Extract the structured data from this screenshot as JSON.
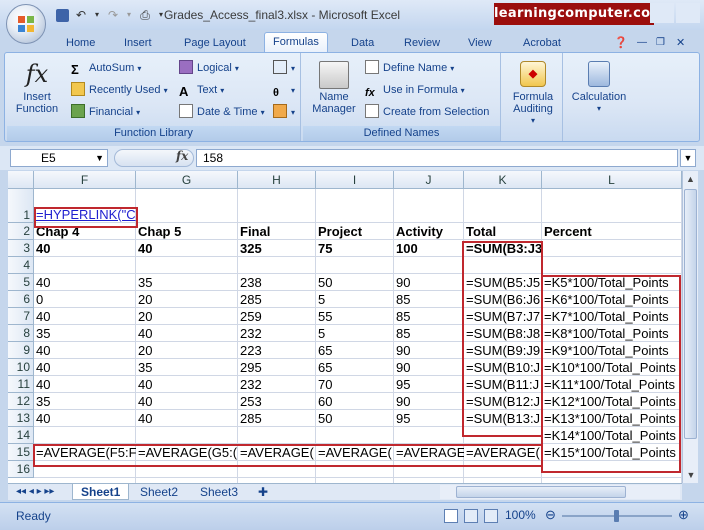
{
  "window": {
    "title": "Grades_Access_final3.xlsx - Microsoft Excel",
    "brand": "learningcomputer.com"
  },
  "ribbon": {
    "tabs": [
      "Home",
      "Insert",
      "Page Layout",
      "Formulas",
      "Data",
      "Review",
      "View",
      "Acrobat"
    ],
    "active_tab": "Formulas",
    "function_library": {
      "insert_function": "Insert\nFunction",
      "autosum": "AutoSum",
      "recently_used": "Recently Used",
      "financial": "Financial",
      "logical": "Logical",
      "text": "Text",
      "date_time": "Date & Time",
      "label": "Function Library"
    },
    "defined_names": {
      "name_manager": "Name\nManager",
      "define_name": "Define Name",
      "use_in_formula": "Use in Formula",
      "create_from_selection": "Create from Selection",
      "label": "Defined Names"
    },
    "formula_auditing": "Formula\nAuditing",
    "calculation": "Calculation"
  },
  "formula_bar": {
    "name_box": "E5",
    "fx": "fx",
    "value": "158"
  },
  "grid": {
    "columns": [
      "F",
      "G",
      "H",
      "I",
      "J",
      "K",
      "L"
    ],
    "rows": [
      "1",
      "2",
      "3",
      "4",
      "5",
      "6",
      "7",
      "8",
      "9",
      "10",
      "11",
      "12",
      "13",
      "14",
      "15",
      "16"
    ],
    "cells": {
      "F1": "=HYPERLINK(\"C",
      "F2": "Chap 4",
      "G2": "Chap 5",
      "H2": "Final",
      "I2": "Project",
      "J2": "Activity",
      "K2": "Total",
      "L2": "Percent",
      "F3": "40",
      "G3": "40",
      "H3": "325",
      "I3": "75",
      "J3": "100",
      "K3": "=SUM(B3:J3",
      "F5": "40",
      "G5": "35",
      "H5": "238",
      "I5": "50",
      "J5": "90",
      "K5": "=SUM(B5:J5",
      "L5": "=K5*100/Total_Points",
      "F6": "0",
      "G6": "20",
      "H6": "285",
      "I6": "5",
      "J6": "85",
      "K6": "=SUM(B6:J6",
      "L6": "=K6*100/Total_Points",
      "F7": "40",
      "G7": "20",
      "H7": "259",
      "I7": "55",
      "J7": "85",
      "K7": "=SUM(B7:J7",
      "L7": "=K7*100/Total_Points",
      "F8": "35",
      "G8": "40",
      "H8": "232",
      "I8": "5",
      "J8": "85",
      "K8": "=SUM(B8:J8",
      "L8": "=K8*100/Total_Points",
      "F9": "40",
      "G9": "20",
      "H9": "223",
      "I9": "65",
      "J9": "90",
      "K9": "=SUM(B9:J9",
      "L9": "=K9*100/Total_Points",
      "F10": "40",
      "G10": "35",
      "H10": "295",
      "I10": "65",
      "J10": "90",
      "K10": "=SUM(B10:J",
      "L10": "=K10*100/Total_Points",
      "F11": "40",
      "G11": "40",
      "H11": "232",
      "I11": "70",
      "J11": "95",
      "K11": "=SUM(B11:J",
      "L11": "=K11*100/Total_Points",
      "F12": "35",
      "G12": "40",
      "H12": "253",
      "I12": "60",
      "J12": "90",
      "K12": "=SUM(B12:J",
      "L12": "=K12*100/Total_Points",
      "F13": "40",
      "G13": "40",
      "H13": "285",
      "I13": "50",
      "J13": "95",
      "K13": "=SUM(B13:J",
      "L13": "=K13*100/Total_Points",
      "L14": "=K14*100/Total_Points",
      "F15": "=AVERAGE(F5:F",
      "G15": "=AVERAGE(G5:(",
      "H15": "=AVERAGE(",
      "I15": "=AVERAGE(",
      "J15": "=AVERAGE",
      "K15": "=AVERAGE(",
      "L15": "=K15*100/Total_Points"
    }
  },
  "sheets": [
    "Sheet1",
    "Sheet2",
    "Sheet3"
  ],
  "active_sheet": "Sheet1",
  "status": {
    "ready": "Ready",
    "zoom": "100%"
  }
}
